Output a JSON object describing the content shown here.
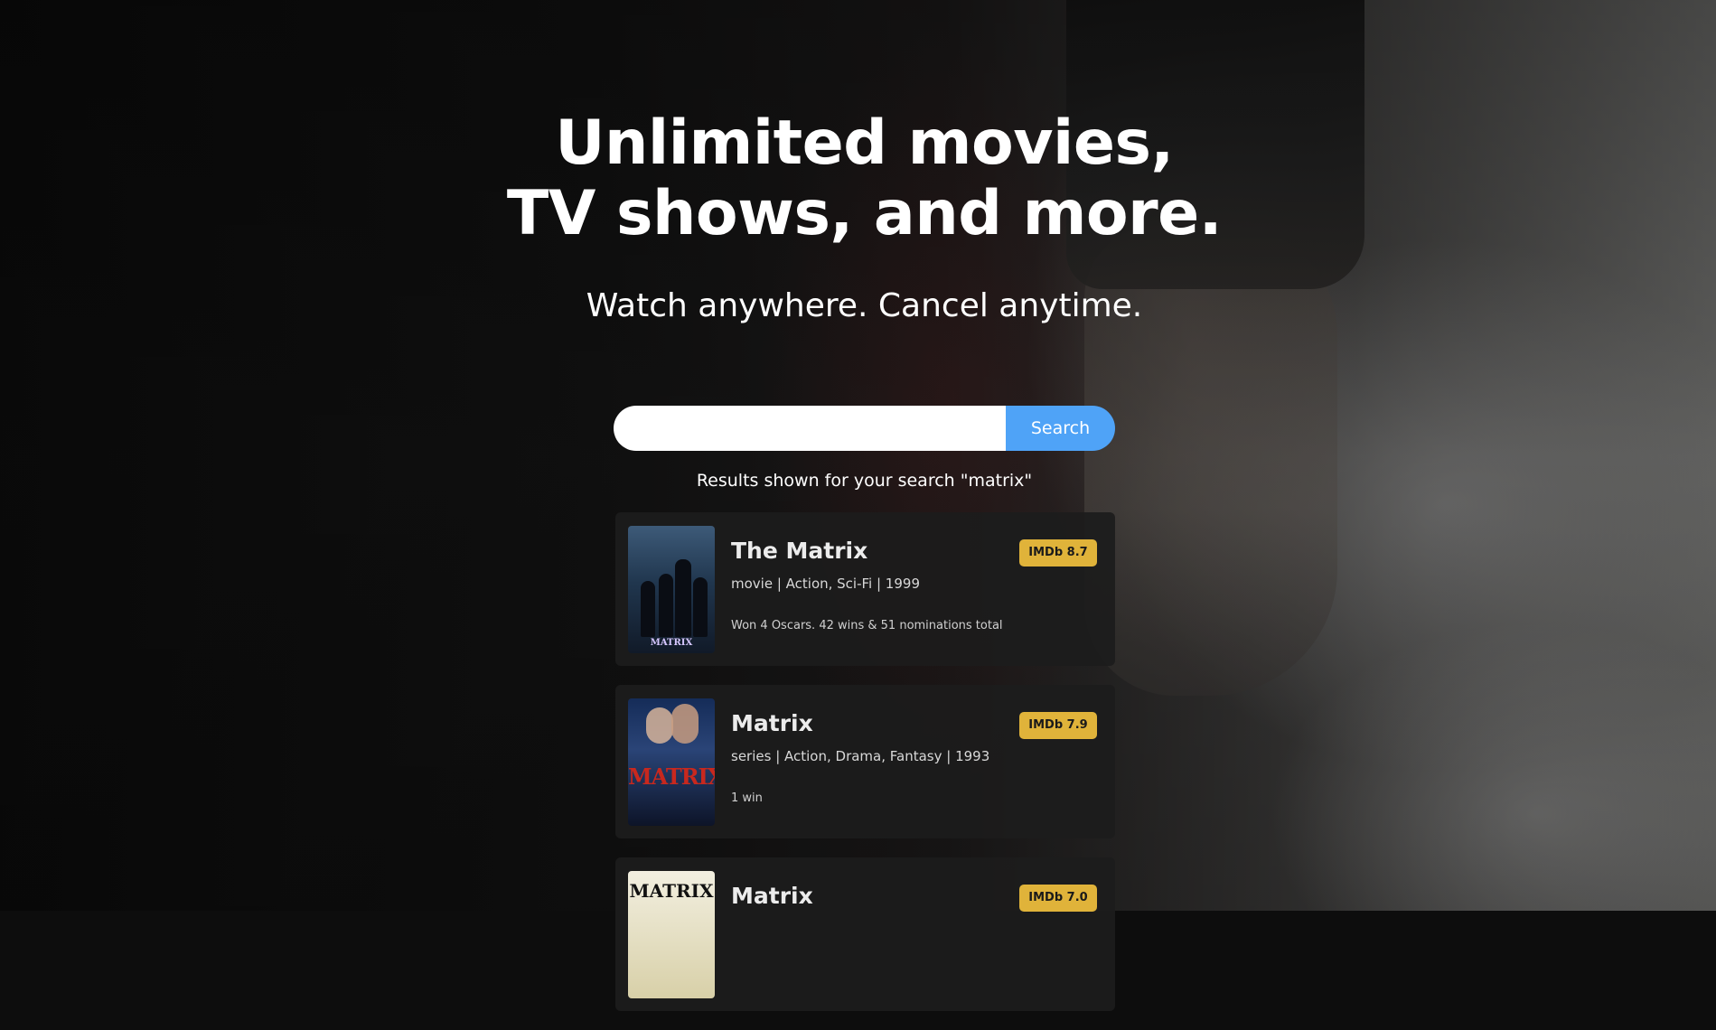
{
  "hero": {
    "headline_line1": "Unlimited movies,",
    "headline_line2": "TV shows, and more.",
    "subtitle": "Watch anywhere. Cancel anytime."
  },
  "search": {
    "value": "",
    "placeholder": "",
    "button_label": "Search"
  },
  "results": {
    "label": "Results shown for your search \"matrix\"",
    "items": [
      {
        "title": "The Matrix",
        "meta": "movie | Action, Sci-Fi | 1999",
        "awards": "Won 4 Oscars. 42 wins & 51 nominations total",
        "rating": "IMDb 8.7",
        "poster_text": "MATRIX"
      },
      {
        "title": "Matrix",
        "meta": "series | Action, Drama, Fantasy | 1993",
        "awards": "1 win",
        "rating": "IMDb 7.9",
        "poster_text": "MATRIX"
      },
      {
        "title": "Matrix",
        "meta": "",
        "awards": "",
        "rating": "IMDb 7.0",
        "poster_text": "MATRIX"
      }
    ]
  },
  "colors": {
    "search_button": "#4fa3f7",
    "rating_badge": "#e0b33a",
    "card_background": "#1c1c1c"
  }
}
